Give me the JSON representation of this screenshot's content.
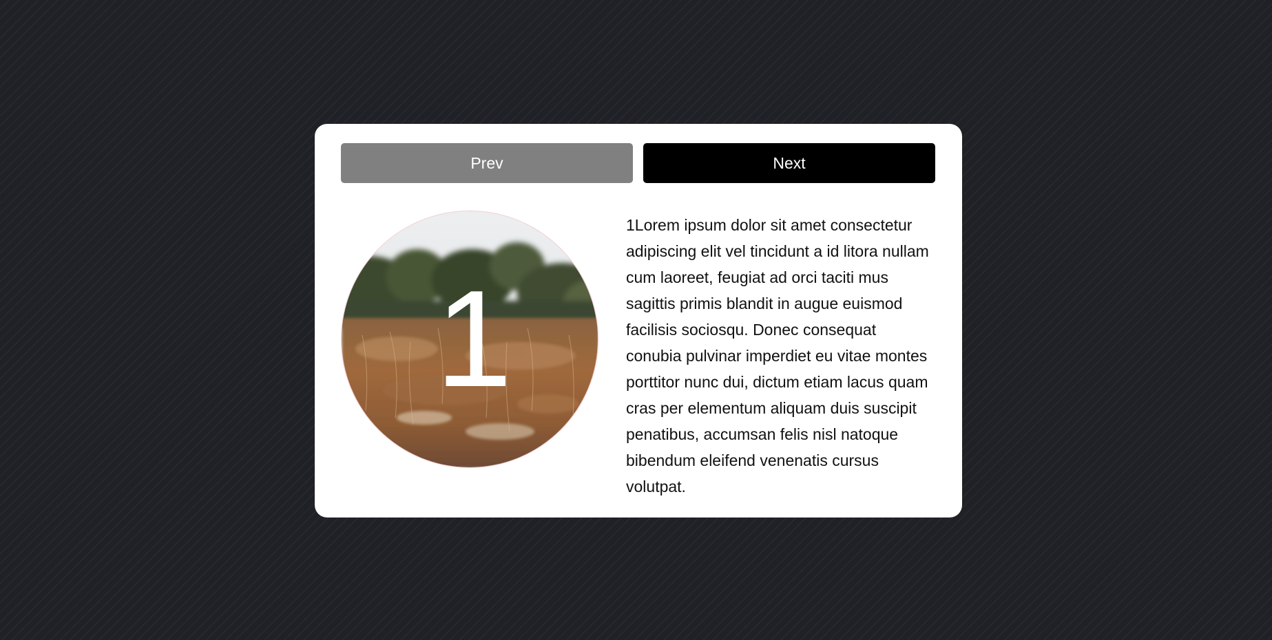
{
  "buttons": {
    "prev_label": "Prev",
    "next_label": "Next"
  },
  "slide": {
    "number": "1",
    "text": "1Lorem ipsum dolor sit amet consectetur adipiscing elit vel tincidunt a id litora nullam cum laoreet, feugiat ad orci taciti mus sagittis primis blandit in augue euismod facilisis sociosqu. Donec consequat conubia pulvinar imperdiet eu vitae montes porttitor nunc dui, dictum etiam lacus quam cras per elementum aliquam duis suscipit penatibus, accumsan felis nisl natoque bibendum eleifend venenatis cursus volutpat."
  },
  "colors": {
    "background": "#202126",
    "card": "#ffffff",
    "prev_button": "#808080",
    "next_button": "#000000"
  }
}
